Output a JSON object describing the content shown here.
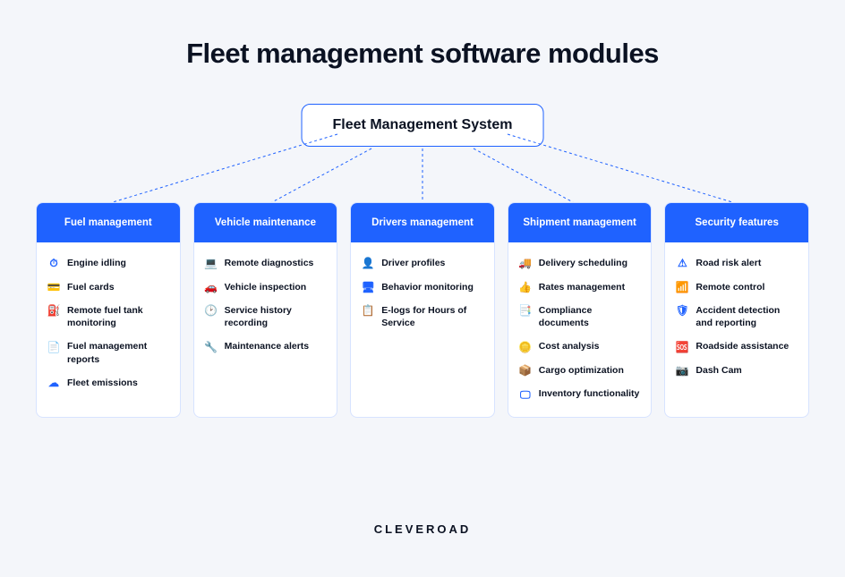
{
  "title": "Fleet management software modules",
  "root": {
    "label": "Fleet Management System"
  },
  "brand": "CLEVEROAD",
  "modules": [
    {
      "title": "Fuel management",
      "items": [
        {
          "icon": "gauge-icon",
          "text": "Engine idling"
        },
        {
          "icon": "card-icon",
          "text": "Fuel cards"
        },
        {
          "icon": "pump-icon",
          "text": "Remote fuel tank monitoring"
        },
        {
          "icon": "report-icon",
          "text": "Fuel management reports"
        },
        {
          "icon": "cloud-icon",
          "text": "Fleet emissions"
        }
      ]
    },
    {
      "title": "Vehicle maintenance",
      "items": [
        {
          "icon": "laptop-icon",
          "text": "Remote diagnostics"
        },
        {
          "icon": "car-icon",
          "text": "Vehicle inspection"
        },
        {
          "icon": "history-icon",
          "text": "Service history recording"
        },
        {
          "icon": "wrench-icon",
          "text": "Maintenance alerts"
        }
      ]
    },
    {
      "title": "Drivers management",
      "items": [
        {
          "icon": "profile-icon",
          "text": "Driver profiles"
        },
        {
          "icon": "monitor-icon",
          "text": "Behavior monitoring"
        },
        {
          "icon": "log-icon",
          "text": "E-logs for Hours of Service"
        }
      ]
    },
    {
      "title": "Shipment management",
      "items": [
        {
          "icon": "truck-icon",
          "text": "Delivery scheduling"
        },
        {
          "icon": "thumb-icon",
          "text": "Rates management"
        },
        {
          "icon": "doc-icon",
          "text": "Compliance documents"
        },
        {
          "icon": "coin-icon",
          "text": "Cost analysis"
        },
        {
          "icon": "box-icon",
          "text": "Cargo optimization"
        },
        {
          "icon": "screen-icon",
          "text": "Inventory functionality"
        }
      ]
    },
    {
      "title": "Security features",
      "items": [
        {
          "icon": "alert-icon",
          "text": "Road risk alert"
        },
        {
          "icon": "remote-icon",
          "text": "Remote control"
        },
        {
          "icon": "shield-icon",
          "text": "Accident detection and reporting"
        },
        {
          "icon": "assist-icon",
          "text": "Roadside assistance"
        },
        {
          "icon": "camera-icon",
          "text": "Dash Cam"
        }
      ]
    }
  ]
}
